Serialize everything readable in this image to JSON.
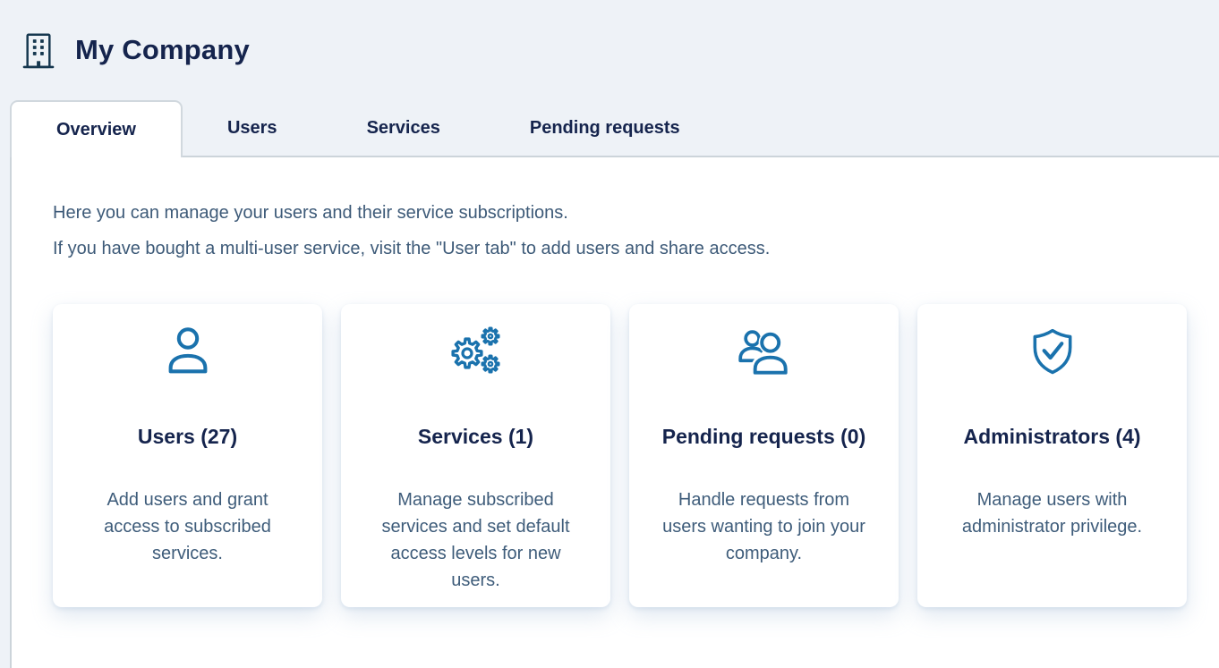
{
  "header": {
    "title": "My Company"
  },
  "tabs": [
    {
      "label": "Overview",
      "active": true
    },
    {
      "label": "Users",
      "active": false
    },
    {
      "label": "Services",
      "active": false
    },
    {
      "label": "Pending requests",
      "active": false
    }
  ],
  "intro": {
    "line1": "Here you can manage your users and their service subscriptions.",
    "line2": "If you have bought a multi-user service, visit the \"User tab\" to add users and share access."
  },
  "cards": [
    {
      "icon": "user-icon",
      "title": "Users (27)",
      "description": "Add users and grant access to subscribed services."
    },
    {
      "icon": "gears-icon",
      "title": "Services (1)",
      "description": "Manage subscribed services and set default access levels for new users."
    },
    {
      "icon": "people-icon",
      "title": "Pending requests (0)",
      "description": "Handle requests from users wanting to join your company."
    },
    {
      "icon": "shield-check-icon",
      "title": "Administrators (4)",
      "description": "Manage users with administrator privilege."
    }
  ],
  "colors": {
    "accent_blue": "#1a72ad",
    "heading_navy": "#15244d",
    "body_text": "#3e5c7a",
    "page_background": "#eef2f7",
    "border_gray": "#ccd4da"
  }
}
